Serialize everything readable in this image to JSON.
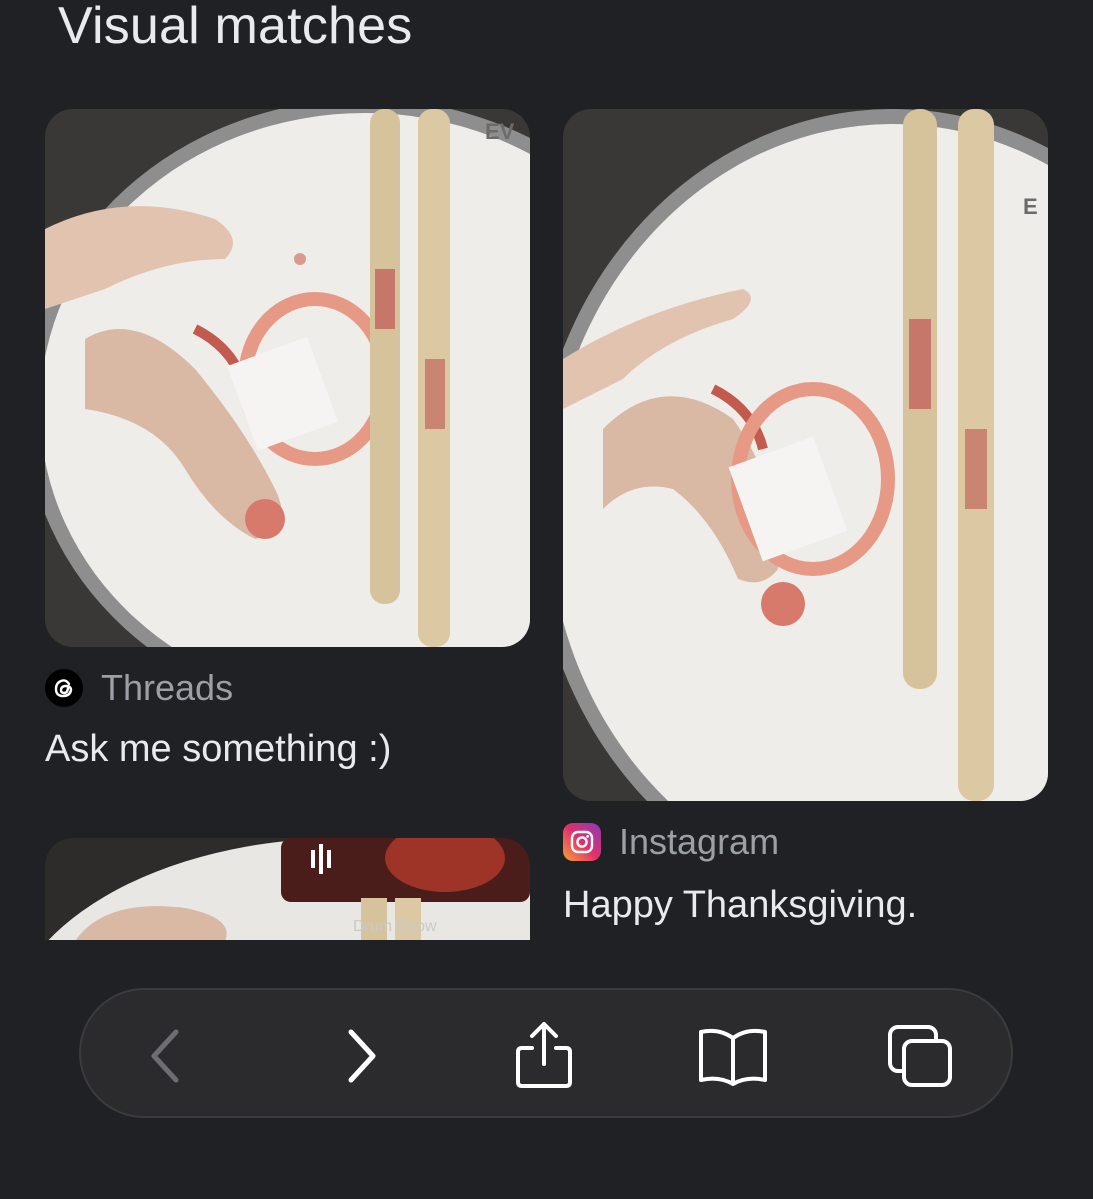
{
  "section": {
    "heading": "Visual matches"
  },
  "results": [
    {
      "source": "Threads",
      "source_icon": "threads-icon",
      "title": "Ask me something :)"
    },
    {
      "source": "Instagram",
      "source_icon": "instagram-icon",
      "title": "Happy Thanksgiving."
    }
  ],
  "partial_result": {
    "overlay_text": "Drum Show"
  },
  "toolbar": {
    "buttons": [
      "back-icon",
      "forward-icon",
      "share-icon",
      "bookmarks-icon",
      "tabs-icon"
    ]
  },
  "colors": {
    "background": "#202124",
    "toolbar": "#2b2b2d",
    "text": "#e8eaed",
    "muted": "#9aa0a6"
  }
}
